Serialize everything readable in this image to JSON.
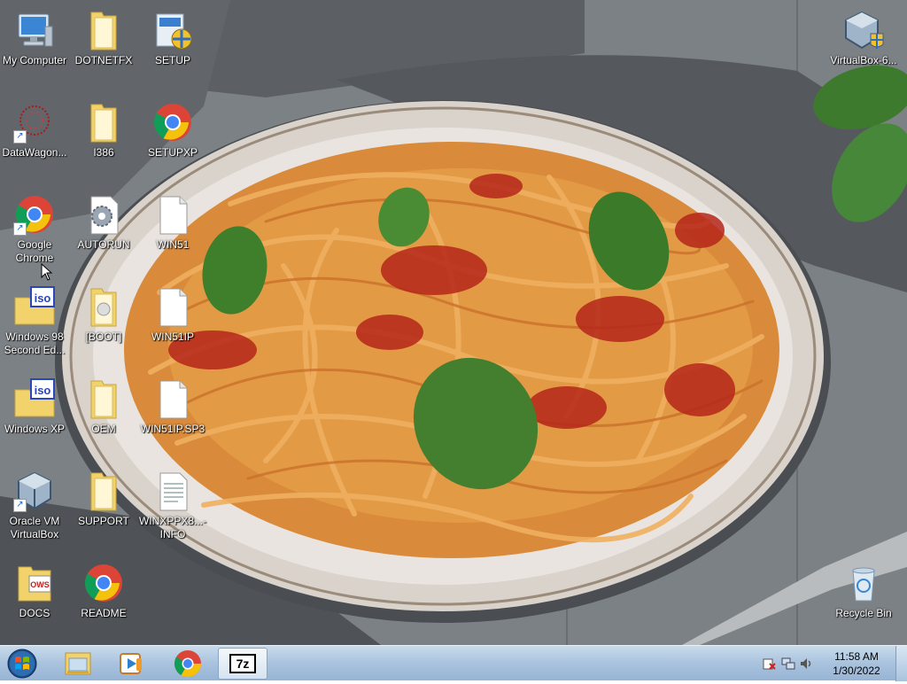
{
  "desktop": {
    "icons": [
      {
        "label": "My Computer",
        "icon": "computer-icon"
      },
      {
        "label": "DOTNETFX",
        "icon": "folder-icon"
      },
      {
        "label": "SETUP",
        "icon": "setup-icon"
      },
      {
        "label": "DataWagon...",
        "icon": "datawagon-icon"
      },
      {
        "label": "I386",
        "icon": "folder-icon"
      },
      {
        "label": "SETUPXP",
        "icon": "chrome-icon"
      },
      {
        "label": "Google Chrome",
        "icon": "chrome-icon"
      },
      {
        "label": "AUTORUN",
        "icon": "settings-file-icon"
      },
      {
        "label": "WIN51",
        "icon": "file-icon"
      },
      {
        "label": "Windows 98 Second Ed...",
        "icon": "iso-icon"
      },
      {
        "label": "[BOOT]",
        "icon": "folder-icon"
      },
      {
        "label": "WIN51IP",
        "icon": "file-icon"
      },
      {
        "label": "Windows XP",
        "icon": "iso-icon"
      },
      {
        "label": "OEM",
        "icon": "folder-icon"
      },
      {
        "label": "WIN51IP.SP3",
        "icon": "file-icon"
      },
      {
        "label": "Oracle VM VirtualBox",
        "icon": "virtualbox-icon"
      },
      {
        "label": "SUPPORT",
        "icon": "folder-icon"
      },
      {
        "label": "WINXPPX8...- INFO",
        "icon": "text-file-icon"
      },
      {
        "label": "DOCS",
        "icon": "folder-icon"
      },
      {
        "label": "README",
        "icon": "chrome-icon"
      },
      {
        "label": "VirtualBox-6...",
        "icon": "virtualbox-installer-icon"
      },
      {
        "label": "Recycle Bin",
        "icon": "recycle-bin-icon"
      }
    ]
  },
  "taskbar": {
    "start": "start-orb-icon",
    "pinned": [
      {
        "icon": "file-explorer-icon"
      },
      {
        "icon": "media-player-icon"
      },
      {
        "icon": "chrome-icon"
      },
      {
        "icon": "7zip-icon",
        "label": "7z"
      }
    ],
    "tray": {
      "icons": [
        "action-center-icon",
        "network-icon",
        "volume-icon"
      ],
      "time": "11:58 AM",
      "date": "1/30/2022"
    }
  },
  "colors": {
    "taskbar": "#a9c3de",
    "label_text": "#ffffff"
  }
}
